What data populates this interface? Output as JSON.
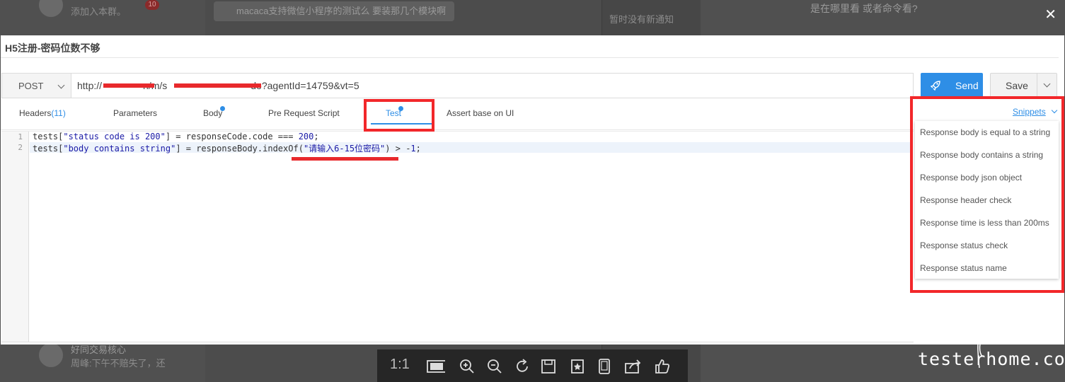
{
  "background": {
    "contact_preview": "添加入本群。",
    "badge": "10",
    "chat_message": "macaca支持微信小程序的测试么 要装那几个模块啊",
    "notice": "暂时没有新通知",
    "right_question": "是在哪里看 或者命令看?",
    "bottom_name": "好同交易核心",
    "bottom_preview": "周峰:下午不赔失了，还"
  },
  "modal": {
    "title": "H5注册-密码位数不够"
  },
  "request": {
    "method": "POST",
    "url": "http://xxxxxxxxxxm/m/sxxxxxxxxxxxxxxxxdo?agentId=14759&vt=5",
    "url_start": "http://",
    "url_mid": "n/m/s",
    "url_end": "do?agentId=14759&vt=5",
    "send_label": "Send",
    "save_label": "Save"
  },
  "tabs": {
    "headers": "Headers",
    "headers_count": "(11)",
    "parameters": "Parameters",
    "body": "Body",
    "pre_request": "Pre Request Script",
    "test": "Test",
    "assert": "Assert base on UI"
  },
  "editor": {
    "line_numbers": [
      "1",
      "2"
    ],
    "line1_a": "tests[",
    "line1_str": "\"status code is 200\"",
    "line1_b": "] = responseCode.code === ",
    "line1_num": "200",
    "line1_c": ";",
    "line2_a": "tests[",
    "line2_str": "\"body contains string\"",
    "line2_b": "] = responseBody.indexOf(",
    "line2_str2": "\"请输入6-15位密码\"",
    "line2_c": ") > -",
    "line2_num": "1",
    "line2_d": ";"
  },
  "snippets": {
    "link": "Snippets",
    "items": [
      "Response body is equal to a string",
      "Response body contains a string",
      "Response body json object",
      "Response header check",
      "Response time is less than 200ms",
      "Response status check",
      "Response status name"
    ]
  },
  "viewer": {
    "ratio": "1:1"
  },
  "watermark": "testerhome.com",
  "colors": {
    "accent": "#2e8ee6",
    "annotation_red": "#f2272a"
  }
}
